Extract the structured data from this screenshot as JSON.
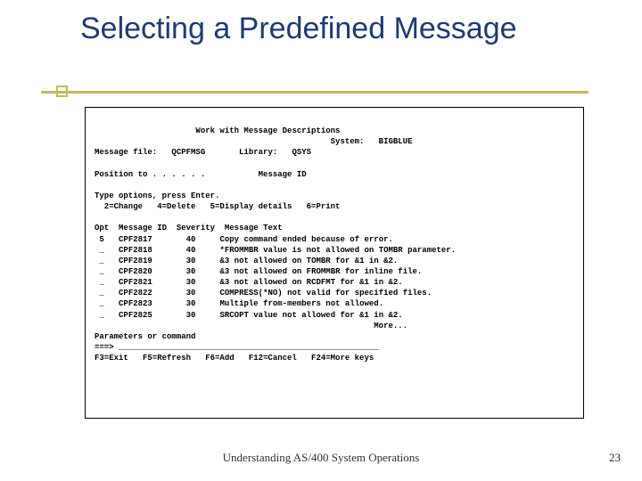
{
  "slide": {
    "title": "Selecting a Predefined Message",
    "footer": "Understanding AS/400 System Operations",
    "page": "23"
  },
  "term": {
    "header_center": "Work with Message Descriptions",
    "system_label": "System:",
    "system_value": "BIGBLUE",
    "msgfile_label": "Message file:",
    "msgfile_value": "QCPFMSG",
    "library_label": "Library:",
    "library_value": "QSYS",
    "position_label": "Position to . . . . . .",
    "position_field": "Message ID",
    "instruct1": "Type options, press Enter.",
    "opts": "  2=Change   4=Delete   5=Display details   6=Print",
    "col_opt": "Opt",
    "col_msgid": "Message ID",
    "col_sev": "Severity",
    "col_text": "Message Text",
    "rows": [
      {
        "opt": "5",
        "id": "CPF2817",
        "sev": "40",
        "text": "Copy command ended because of error."
      },
      {
        "opt": "_",
        "id": "CPF2818",
        "sev": "40",
        "text": "*FROMMBR value is not allowed on TOMBR parameter."
      },
      {
        "opt": "_",
        "id": "CPF2819",
        "sev": "30",
        "text": "&3 not allowed on TOMBR for &1 in &2."
      },
      {
        "opt": "_",
        "id": "CPF2820",
        "sev": "30",
        "text": "&3 not allowed on FROMMBR for inline file."
      },
      {
        "opt": "_",
        "id": "CPF2821",
        "sev": "30",
        "text": "&3 not allowed on RCDFMT for &1 in &2."
      },
      {
        "opt": "_",
        "id": "CPF2822",
        "sev": "30",
        "text": "COMPRESS(*NO) not valid for specified files."
      },
      {
        "opt": "_",
        "id": "CPF2823",
        "sev": "30",
        "text": "Multiple from-members not allowed."
      },
      {
        "opt": "_",
        "id": "CPF2825",
        "sev": "30",
        "text": "SRCOPT value not allowed for &1 in &2."
      }
    ],
    "more": "More...",
    "params_label": "Parameters or command",
    "prompt": "===>",
    "cmdline": "______________________________________________________",
    "fkeys": "F3=Exit   F5=Refresh   F6=Add   F12=Cancel   F24=More keys"
  }
}
